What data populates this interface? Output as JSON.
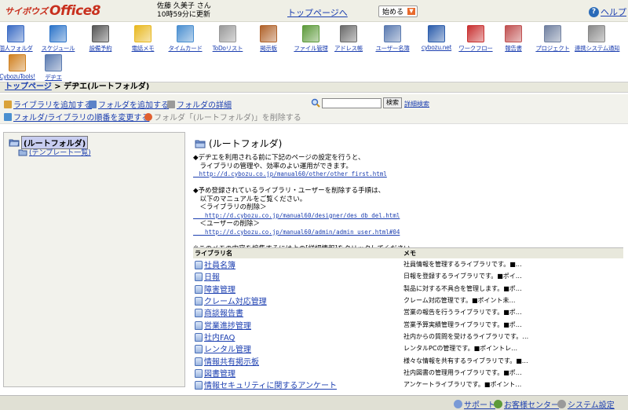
{
  "header": {
    "logo_prefix": "サイボウズ",
    "logo_main": "Office8",
    "user_name": "佐藤 久美子 さん",
    "updated": "10時59分に更新",
    "toppage": "トップページへ",
    "start_menu": "始める",
    "help": "ヘルプ"
  },
  "apps": [
    {
      "label": "個人フォルダ",
      "icon": "personal-folder-icon",
      "color": "#3a6bc4"
    },
    {
      "label": "スケジュール",
      "icon": "schedule-icon",
      "color": "#2c74c9"
    },
    {
      "label": "設備予約",
      "icon": "facility-icon",
      "color": "#555555"
    },
    {
      "label": "電話メモ",
      "icon": "phone-memo-icon",
      "color": "#e8b820"
    },
    {
      "label": "タイムカード",
      "icon": "timecard-icon",
      "color": "#4a8fd0"
    },
    {
      "label": "ToDoリスト",
      "icon": "todo-icon",
      "color": "#999999"
    },
    {
      "label": "掲示板",
      "icon": "bulletin-icon",
      "color": "#b0622a"
    },
    {
      "label": "ファイル管理",
      "icon": "file-icon",
      "color": "#5c9a3a"
    },
    {
      "label": "アドレス帳",
      "icon": "address-book-icon",
      "color": "#6a6a6a"
    },
    {
      "label": "ユーザー名簿",
      "icon": "user-list-icon",
      "color": "#5a7ab0"
    },
    {
      "label": "cybozu.net",
      "icon": "cybozu-net-icon",
      "color": "#2b5cab"
    },
    {
      "label": "ワークフロー",
      "icon": "workflow-icon",
      "color": "#c83030"
    },
    {
      "label": "報告書",
      "icon": "report-icon",
      "color": "#c05050"
    },
    {
      "label": "プロジェクト",
      "icon": "project-icon",
      "color": "#7080a0"
    },
    {
      "label": "連携システム通知",
      "icon": "system-notify-icon",
      "color": "#888888"
    },
    {
      "label": "CybozuTools!",
      "icon": "tools-icon",
      "color": "#d08020"
    },
    {
      "label": "デヂエ",
      "icon": "dezie-icon",
      "color": "#5a7ab0"
    }
  ],
  "breadcrumb": {
    "top": "トップページ",
    "sep": " > ",
    "current": "デヂエ(ルートフォルダ)"
  },
  "toolbar": {
    "add_library": "ライブラリを追加する",
    "add_folder": "フォルダを追加する",
    "folder_details": "フォルダの詳細",
    "reorder": "フォルダ/ライブラリの順番を変更する",
    "delete_folder": "フォルダ「(ルートフォルダ)」を削除する",
    "search_button": "検索",
    "advanced_search": "詳細検索",
    "search_value": ""
  },
  "tree": {
    "root": "(ルートフォルダ)",
    "child": "(テンプレート一覧)"
  },
  "main": {
    "title": "(ルートフォルダ)",
    "memo_lines": [
      "◆デヂエを利用される前に下記のページの設定を行うと、",
      "　ライブラリの管理や、効率のよい運用ができます。",
      "　http://d.cybozu.co.jp/manual60/other/other_first.html",
      "",
      "◆予め登録されているライブラリ・ユーザーを削除する手順は、",
      "　以下のマニュアルをご覧ください。",
      "　＜ライブラリの削除＞",
      "　　http://d.cybozu.co.jp/manual60/designer/des_db_del.html",
      "　＜ユーザーの削除＞",
      "　　http://d.cybozu.co.jp/manual60/admin/admin_user.html#04",
      "",
      "※このメモの内容を編集するには上の[詳細情報]をクリックしてください。"
    ],
    "col_name": "ライブラリ名",
    "col_memo": "メモ",
    "libraries": [
      {
        "name": "社員名簿",
        "memo": "社員情報を管理するライブラリです。■…"
      },
      {
        "name": "日報",
        "memo": "日報を登録するライブラリです。■ポイ…"
      },
      {
        "name": "障害管理",
        "memo": "製品に対する不具合を管理します。■ポ…"
      },
      {
        "name": "クレーム対応管理",
        "memo": "クレーム対応管理です。■ポイント未…"
      },
      {
        "name": "商談報告書",
        "memo": "営業の報告を行うライブラリです。■ポ…"
      },
      {
        "name": "営業進捗管理",
        "memo": "営業予算実績管理ライブラリです。■ポ…"
      },
      {
        "name": "社内FAQ",
        "memo": "社内からの質問を受けるライブラリです。…"
      },
      {
        "name": "レンタル管理",
        "memo": "レンタルPCの管理です。■ポイントレ…"
      },
      {
        "name": "情報共有掲示板",
        "memo": "様々な情報を共有するライブラリです。■…"
      },
      {
        "name": "図書管理",
        "memo": "社内図書の管理用ライブラリです。■ポ…"
      },
      {
        "name": "情報セキュリティに関するアンケート",
        "memo": "アンケートライブラリです。■ポイント…"
      }
    ]
  },
  "footer": {
    "support": "サポート",
    "customer_center": "お客様センター",
    "system_settings": "システム設定"
  }
}
